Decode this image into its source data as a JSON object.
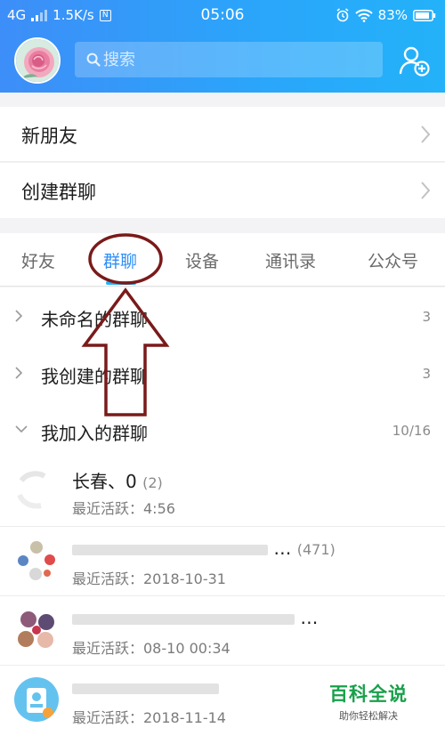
{
  "status_bar": {
    "network": "4G",
    "speed": "1.5K/s",
    "nfc": "N",
    "time": "05:06",
    "battery": "83%"
  },
  "header": {
    "search_placeholder": "搜索"
  },
  "menu_rows": [
    {
      "label": "新朋友"
    },
    {
      "label": "创建群聊"
    }
  ],
  "tabs": [
    {
      "label": "好友"
    },
    {
      "label": "群聊",
      "active": true
    },
    {
      "label": "设备"
    },
    {
      "label": "通讯录"
    },
    {
      "label": "公众号"
    }
  ],
  "groups": [
    {
      "label": "未命名的群聊",
      "count": "3",
      "expanded": false
    },
    {
      "label": "我创建的群聊",
      "count": "3",
      "expanded": false
    },
    {
      "label": "我加入的群聊",
      "count": "10/16",
      "expanded": true
    }
  ],
  "chats": [
    {
      "name": "长春、0",
      "members": "(2)",
      "activity": "最近活跃：4:56"
    },
    {
      "name": "…",
      "members": "(471)",
      "activity": "最近活跃：2018-10-31"
    },
    {
      "name": "…",
      "members": "",
      "activity": "最近活跃：08-10 00:34"
    },
    {
      "name": "",
      "members": "",
      "activity": "最近活跃：2018-11-14"
    }
  ],
  "watermark": {
    "title": "百科全说",
    "subtitle": "助你轻松解决"
  },
  "colors": {
    "header_start": "#3d8ef8",
    "header_end": "#23b2f9",
    "active_tab": "#2f8ff7",
    "annotation": "#7a1a1a",
    "watermark": "#19a04b"
  }
}
